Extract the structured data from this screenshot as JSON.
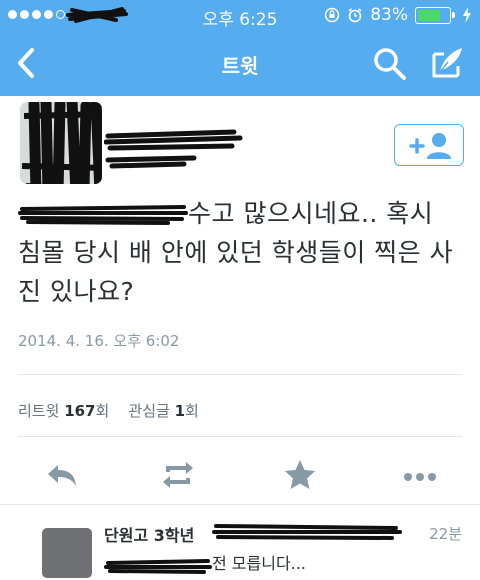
{
  "status_bar": {
    "time": "오후 6:25",
    "battery": "83%",
    "battery_level": 0.83
  },
  "nav": {
    "title": "트윗"
  },
  "tweet": {
    "text": "수고 많으시네요.. 혹시 침몰 당시 배 안에 있던 학생들이 찍은 사진 있나요?",
    "timestamp": "2014. 4. 16. 오후 6:02"
  },
  "stats": {
    "retweet_label": "리트윗",
    "retweet_count": "167",
    "retweet_unit": "회",
    "fav_label": "관심글",
    "fav_count": "1",
    "fav_unit": "회"
  },
  "reply": {
    "name": "단원고 3학년",
    "time": "22분",
    "text": "전 모릅니다..."
  },
  "colors": {
    "brand": "#55acee",
    "battery": "#4cd964",
    "icon_gray": "#8899a6"
  },
  "icons": [
    "back-chevron",
    "search",
    "compose",
    "add-user",
    "reply",
    "retweet",
    "favorite-star",
    "more-dots"
  ]
}
